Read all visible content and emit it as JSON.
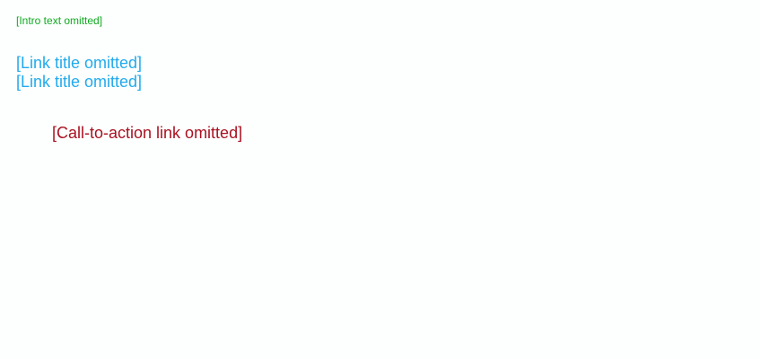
{
  "intro": "[Intro text omitted]",
  "links": [
    "[Link title omitted]",
    "[Link title omitted]"
  ],
  "cta": "[Call-to-action link omitted]"
}
